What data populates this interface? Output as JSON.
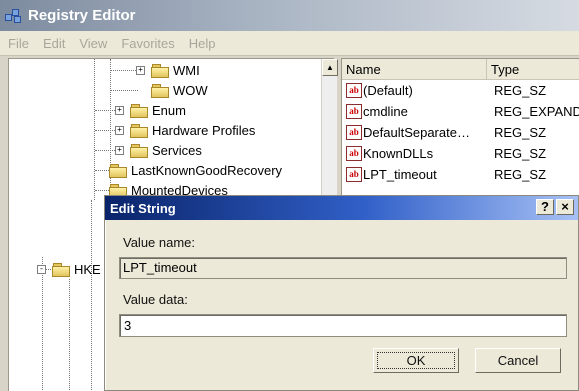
{
  "window": {
    "title": "Registry Editor",
    "icon": "registry-editor-icon"
  },
  "menu": [
    {
      "label": "File"
    },
    {
      "label": "Edit"
    },
    {
      "label": "View"
    },
    {
      "label": "Favorites"
    },
    {
      "label": "Help"
    }
  ],
  "tree": {
    "nodes": [
      {
        "label": "WMI",
        "expander": "+",
        "icon": "folder-icon"
      },
      {
        "label": "WOW",
        "icon": "folder-open-icon"
      },
      {
        "label": "Enum",
        "expander": "+",
        "icon": "folder-icon"
      },
      {
        "label": "Hardware Profiles",
        "expander": "+",
        "icon": "folder-icon"
      },
      {
        "label": "Services",
        "expander": "+",
        "icon": "folder-icon"
      },
      {
        "label": "LastKnownGoodRecovery",
        "icon": "folder-icon"
      },
      {
        "label": "MountedDevices",
        "icon": "folder-icon"
      },
      {
        "label": "HKE",
        "expander": "-",
        "icon": "folder-icon"
      }
    ],
    "scroll_up_icon": "scroll-up-icon"
  },
  "list": {
    "columns": [
      {
        "label": "Name"
      },
      {
        "label": "Type"
      }
    ],
    "rows": [
      {
        "name": "(Default)",
        "type": "REG_SZ",
        "icon_label": "ab"
      },
      {
        "name": "cmdline",
        "type": "REG_EXPAND",
        "icon_label": "ab"
      },
      {
        "name": "DefaultSeparate…",
        "type": "REG_SZ",
        "icon_label": "ab"
      },
      {
        "name": "KnownDLLs",
        "type": "REG_SZ",
        "icon_label": "ab"
      },
      {
        "name": "LPT_timeout",
        "type": "REG_SZ",
        "icon_label": "ab"
      }
    ]
  },
  "dialog": {
    "title": "Edit String",
    "help_label": "?",
    "close_label": "×",
    "value_name_label": "Value name:",
    "value_name": "LPT_timeout",
    "value_data_label": "Value data:",
    "value_data": "3",
    "ok_label": "OK",
    "cancel_label": "Cancel"
  },
  "colors": {
    "dialog_title_start": "#0a246a",
    "dialog_title_end": "#a7c1f5",
    "registry_string_icon": "#cc0000"
  }
}
